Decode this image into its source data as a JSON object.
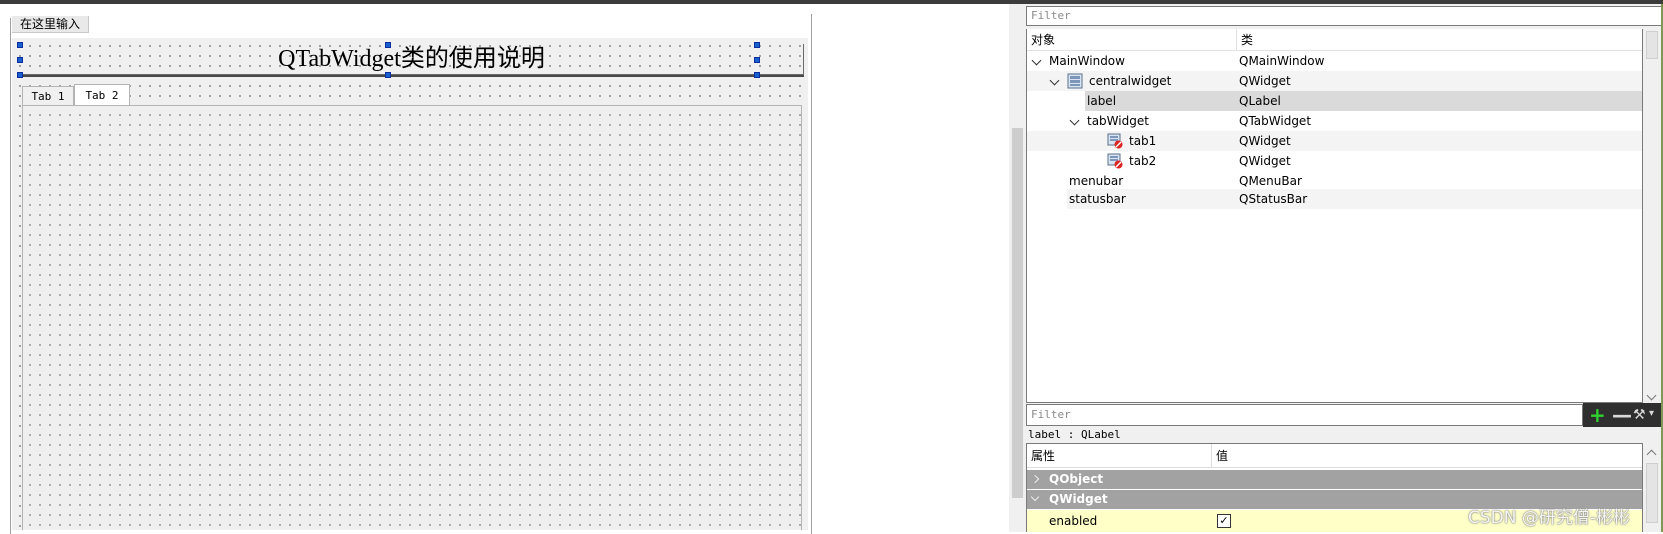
{
  "designer": {
    "menu_placeholder": "在这里输入",
    "label_text": "QTabWidget类的使用说明",
    "tabs": [
      "Tab 1",
      "Tab 2"
    ],
    "current_tab_index": 1
  },
  "object_inspector": {
    "filter_placeholder": "Filter",
    "columns": [
      "对象",
      "类"
    ],
    "rows": [
      {
        "object": "MainWindow",
        "class": "QMainWindow",
        "depth": 0,
        "expanded": true,
        "icon": ""
      },
      {
        "object": "centralwidget",
        "class": "QWidget",
        "depth": 1,
        "expanded": true,
        "icon": "layout-icon"
      },
      {
        "object": "label",
        "class": "QLabel",
        "depth": 2,
        "selected": true,
        "icon": ""
      },
      {
        "object": "tabWidget",
        "class": "QTabWidget",
        "depth": 2,
        "expanded": true,
        "icon": ""
      },
      {
        "object": "tab1",
        "class": "QWidget",
        "depth": 3,
        "icon": "broken-layout-icon"
      },
      {
        "object": "tab2",
        "class": "QWidget",
        "depth": 3,
        "icon": "broken-layout-icon"
      },
      {
        "object": "menubar",
        "class": "QMenuBar",
        "depth": 1,
        "icon": ""
      },
      {
        "object": "statusbar",
        "class": "QStatusBar",
        "depth": 1,
        "icon": ""
      }
    ]
  },
  "property_editor": {
    "filter_placeholder": "Filter",
    "toolbar": {
      "add_icon": "plus-icon",
      "remove_icon": "minus-icon",
      "config_icon": "wrench-icon"
    },
    "object_class_line": "label : QLabel",
    "columns": [
      "属性",
      "值"
    ],
    "groups": [
      "QObject",
      "QWidget"
    ],
    "properties": [
      {
        "name": "enabled",
        "checked": true,
        "check_mark": "✓"
      }
    ]
  },
  "watermark": "CSDN @研究僧-彬彬",
  "colors": {
    "handle": "#1a5fd0",
    "group_bg": "#a2a2a2",
    "row_selected": "#dadada",
    "prop_highlight": "#ffffc8",
    "add_green": "#2fd12f"
  }
}
